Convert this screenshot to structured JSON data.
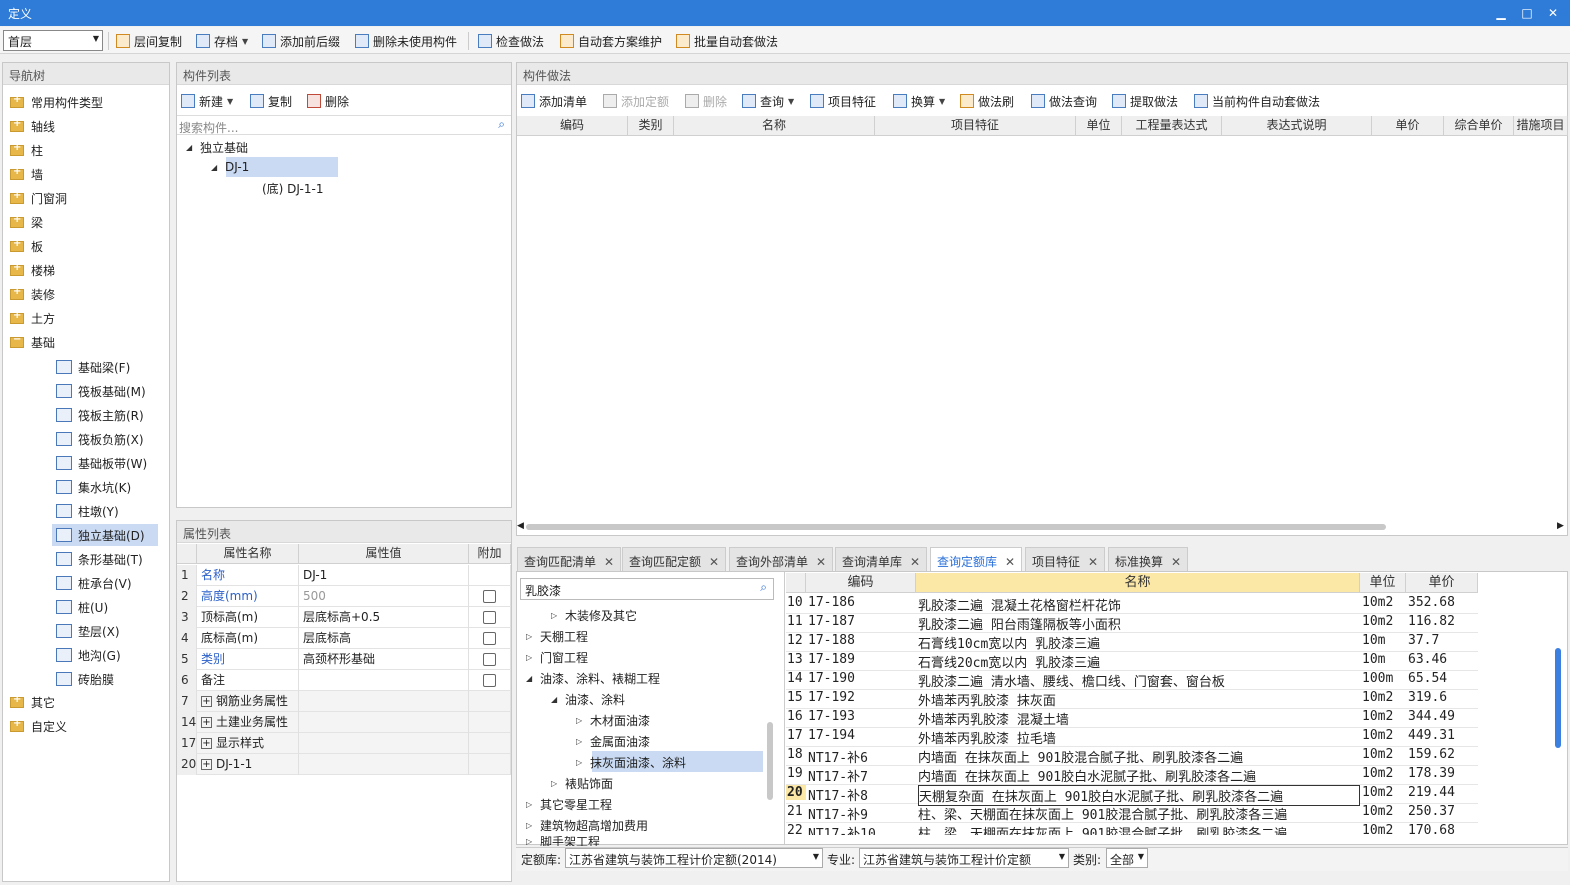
{
  "window": {
    "title": "定义"
  },
  "toolbar": {
    "floor": "首层",
    "copy": "层间复制",
    "save": "存档",
    "prefix": "添加前后缀",
    "delete_unused": "删除未使用构件",
    "check": "检查做法",
    "auto_maint": "自动套方案维护",
    "batch_auto": "批量自动套做法"
  },
  "nav": {
    "title": "导航树",
    "items": [
      "常用构件类型",
      "轴线",
      "柱",
      "墙",
      "门窗洞",
      "梁",
      "板",
      "楼梯",
      "装修",
      "土方",
      "基础"
    ],
    "sub": [
      "基础梁(F)",
      "筏板基础(M)",
      "筏板主筋(R)",
      "筏板负筋(X)",
      "基础板带(W)",
      "集水坑(K)",
      "柱墩(Y)",
      "独立基础(D)",
      "条形基础(T)",
      "桩承台(V)",
      "桩(U)",
      "垫层(X)",
      "地沟(G)",
      "砖胎膜"
    ],
    "tail": [
      "其它",
      "自定义"
    ]
  },
  "comp": {
    "title": "构件列表",
    "new": "新建",
    "copy": "复制",
    "delete": "删除",
    "search_placeholder": "搜索构件...",
    "tree": [
      "独立基础",
      "DJ-1",
      "(底) DJ-1-1"
    ]
  },
  "props": {
    "title": "属性列表",
    "headers": [
      "属性名称",
      "属性值",
      "附加"
    ],
    "rows": [
      {
        "no": "1",
        "name": "名称",
        "value": "DJ-1"
      },
      {
        "no": "2",
        "name": "高度(mm)",
        "value": "500"
      },
      {
        "no": "3",
        "name": "顶标高(m)",
        "value": "层底标高+0.5"
      },
      {
        "no": "4",
        "name": "底标高(m)",
        "value": "层底标高"
      },
      {
        "no": "5",
        "name": "类别",
        "value": "高颈杯形基础"
      },
      {
        "no": "6",
        "name": "备注",
        "value": ""
      },
      {
        "no": "7",
        "name": "钢筋业务属性",
        "value": ""
      },
      {
        "no": "14",
        "name": "土建业务属性",
        "value": ""
      },
      {
        "no": "17",
        "name": "显示样式",
        "value": ""
      },
      {
        "no": "20",
        "name": "DJ-1-1",
        "value": ""
      }
    ]
  },
  "method": {
    "title": "构件做法",
    "buttons": [
      "添加清单",
      "添加定额",
      "删除",
      "查询",
      "项目特征",
      "换算",
      "做法刷",
      "做法查询",
      "提取做法",
      "当前构件自动套做法"
    ],
    "headers": [
      "编码",
      "类别",
      "名称",
      "项目特征",
      "单位",
      "工程量表达式",
      "表达式说明",
      "单价",
      "综合单价",
      "措施项目"
    ]
  },
  "tabs": [
    "查询匹配清单",
    "查询匹配定额",
    "查询外部清单",
    "查询清单库",
    "查询定额库",
    "项目特征",
    "标准换算"
  ],
  "lib": {
    "search": "乳胶漆",
    "tree": [
      "木装修及其它",
      "天棚工程",
      "门窗工程",
      "油漆、涂料、裱糊工程",
      "油漆、涂料",
      "木材面油漆",
      "金属面油漆",
      "抹灰面油漆、涂料",
      "裱贴饰面",
      "其它零星工程",
      "建筑物超高增加费用",
      "脚手架工程"
    ],
    "headers": [
      "编码",
      "名称",
      "单位",
      "单价"
    ],
    "rows": [
      {
        "n": "10",
        "code": "17-186",
        "name": "乳胶漆二遍 混凝土花格窗栏杆花饰",
        "unit": "10m2",
        "price": "352.68"
      },
      {
        "n": "11",
        "code": "17-187",
        "name": "乳胶漆二遍 阳台雨篷隔板等小面积",
        "unit": "10m2",
        "price": "116.82"
      },
      {
        "n": "12",
        "code": "17-188",
        "name": "石膏线10cm宽以内 乳胶漆三遍",
        "unit": "10m",
        "price": "37.7"
      },
      {
        "n": "13",
        "code": "17-189",
        "name": "石膏线20cm宽以内 乳胶漆三遍",
        "unit": "10m",
        "price": "63.46"
      },
      {
        "n": "14",
        "code": "17-190",
        "name": "乳胶漆二遍 清水墙、腰线、檐口线、门窗套、窗台板",
        "unit": "100m",
        "price": "65.54"
      },
      {
        "n": "15",
        "code": "17-192",
        "name": "外墙苯丙乳胶漆 抹灰面",
        "unit": "10m2",
        "price": "319.6"
      },
      {
        "n": "16",
        "code": "17-193",
        "name": "外墙苯丙乳胶漆 混凝土墙",
        "unit": "10m2",
        "price": "344.49"
      },
      {
        "n": "17",
        "code": "17-194",
        "name": "外墙苯丙乳胶漆 拉毛墙",
        "unit": "10m2",
        "price": "449.31"
      },
      {
        "n": "18",
        "code": "NT17-补6",
        "name": "内墙面 在抹灰面上 901胶混合腻子批、刷乳胶漆各二遍",
        "unit": "10m2",
        "price": "159.62"
      },
      {
        "n": "19",
        "code": "NT17-补7",
        "name": "内墙面 在抹灰面上 901胶白水泥腻子批、刷乳胶漆各二遍",
        "unit": "10m2",
        "price": "178.39"
      },
      {
        "n": "20",
        "code": "NT17-补8",
        "name": "天棚复杂面 在抹灰面上 901胶白水泥腻子批、刷乳胶漆各二遍",
        "unit": "10m2",
        "price": "219.44"
      },
      {
        "n": "21",
        "code": "NT17-补9",
        "name": "柱、梁、天棚面在抹灰面上 901胶混合腻子批、刷乳胶漆各三遍",
        "unit": "10m2",
        "price": "250.37"
      },
      {
        "n": "22",
        "code": "NT17-补10",
        "name": "柱、梁、天棚面在抹灰面上 901胶混合腻子批、刷乳胶漆各二遍",
        "unit": "10m2",
        "price": "170.68"
      }
    ],
    "footer": {
      "lib_label": "定额库:",
      "lib_value": "江苏省建筑与装饰工程计价定额(2014)",
      "spec_label": "专业:",
      "spec_value": "江苏省建筑与装饰工程计价定额",
      "type_label": "类别:",
      "type_value": "全部"
    }
  }
}
